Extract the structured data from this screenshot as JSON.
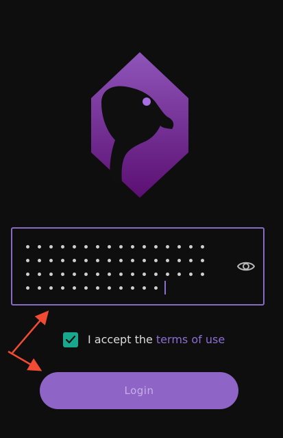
{
  "logo": {
    "icon": "goose-hexagon-logo",
    "color_top": "#8f55b9",
    "color_bottom": "#5b0f72"
  },
  "password": {
    "masked_rows": [
      16,
      16,
      16,
      12
    ],
    "eye_icon": "eye-icon",
    "border_color": "#8a6bc2"
  },
  "terms": {
    "checkbox_checked": true,
    "prefix": "I accept the ",
    "link": "terms of use"
  },
  "login": {
    "label": "Login",
    "color": "#8e64c6"
  },
  "annotations": {
    "arrow_color": "#f24b33"
  }
}
